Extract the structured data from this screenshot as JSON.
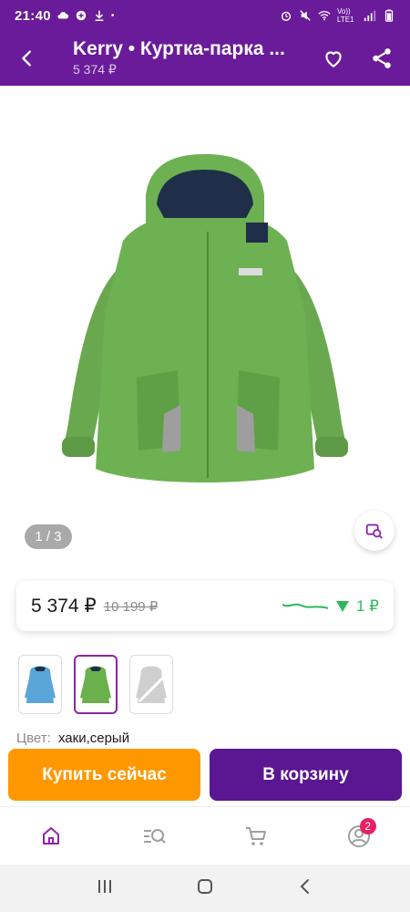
{
  "status_bar": {
    "time": "21:40",
    "network": "Vo)) LTE1"
  },
  "app_bar": {
    "title": "Kerry • Куртка-парка ...",
    "subtitle": "5 374 ₽"
  },
  "gallery": {
    "pager": "1 / 3"
  },
  "price_card": {
    "price": "5 374 ₽",
    "old_price": "10 199 ₽",
    "change": "1 ₽",
    "change_color": "#2eb85c"
  },
  "variants": [
    {
      "name": "blue",
      "color": "#5aa6d8",
      "selected": false
    },
    {
      "name": "green",
      "color": "#6ab04c",
      "selected": true
    },
    {
      "name": "grey",
      "color": "#cfcfcf",
      "selected": false
    }
  ],
  "color_info": {
    "label": "Цвет:",
    "value": "хаки,серый"
  },
  "actions": {
    "buy_now": "Купить сейчас",
    "add_to_cart": "В корзину"
  },
  "bottom_nav": {
    "items": [
      "home-icon",
      "catalog-search-icon",
      "cart-icon",
      "profile-icon"
    ],
    "profile_badge": "2"
  },
  "colors": {
    "brand": "#6a1b9a",
    "accent": "#ff9800",
    "cart": "#5b1691"
  }
}
